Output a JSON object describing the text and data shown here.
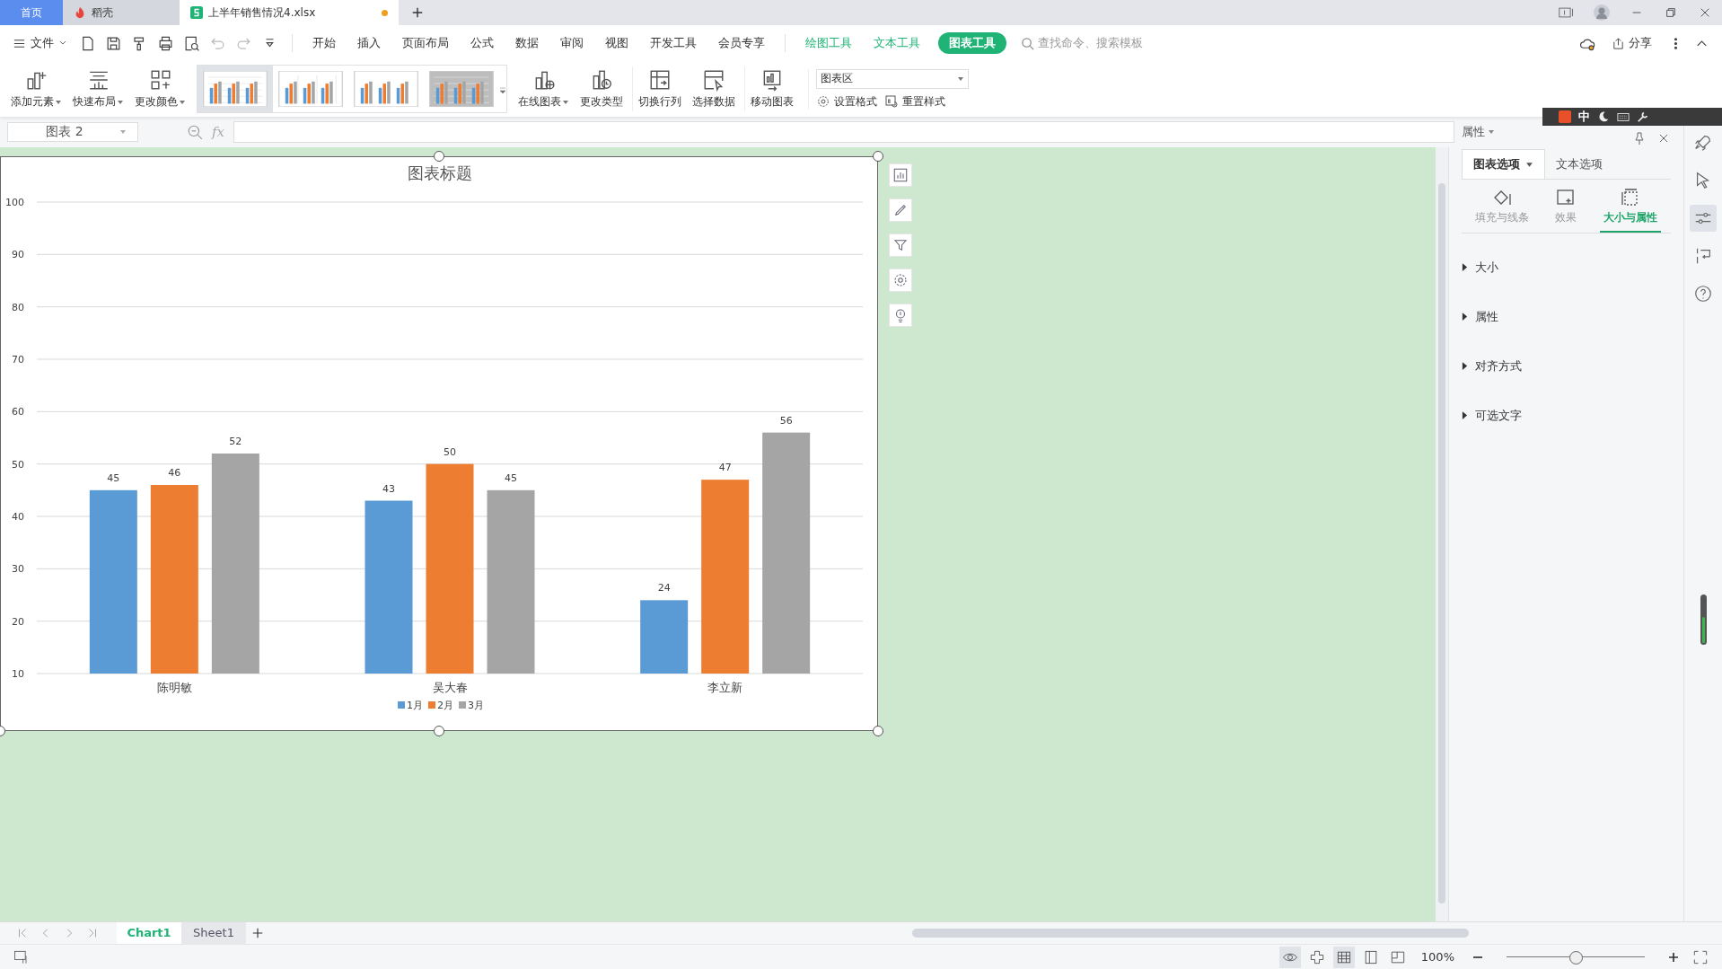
{
  "tabs": [
    {
      "label": "首页",
      "selected": false,
      "kind": "home"
    },
    {
      "label": "稻壳",
      "selected": false,
      "kind": "docer"
    },
    {
      "label": "上半年销售情况4.xlsx",
      "selected": true,
      "kind": "sheet",
      "unsaved": true
    }
  ],
  "menu": {
    "file": "文件",
    "items": [
      {
        "label": "开始",
        "kind": "plain",
        "selected": false
      },
      {
        "label": "插入",
        "kind": "plain",
        "selected": false
      },
      {
        "label": "页面布局",
        "kind": "plain",
        "selected": false
      },
      {
        "label": "公式",
        "kind": "plain",
        "selected": false
      },
      {
        "label": "数据",
        "kind": "plain",
        "selected": false
      },
      {
        "label": "审阅",
        "kind": "plain",
        "selected": false
      },
      {
        "label": "视图",
        "kind": "plain",
        "selected": false
      },
      {
        "label": "开发工具",
        "kind": "plain",
        "selected": false
      },
      {
        "label": "会员专享",
        "kind": "plain",
        "selected": false
      },
      {
        "label": "绘图工具",
        "kind": "context",
        "selected": false
      },
      {
        "label": "文本工具",
        "kind": "context",
        "selected": false
      },
      {
        "label": "图表工具",
        "kind": "context",
        "selected": true
      }
    ],
    "search_placeholder": "查找命令、搜索模板",
    "share": "分享"
  },
  "ribbon": {
    "left": [
      {
        "label": "添加元素",
        "kind": "add",
        "dropdown": true
      },
      {
        "label": "快速布局",
        "kind": "layout",
        "dropdown": true
      },
      {
        "label": "更改颜色",
        "kind": "colors",
        "dropdown": true
      }
    ],
    "styles": [
      {
        "selected": true,
        "kind": "light"
      },
      {
        "selected": false,
        "kind": "lines"
      },
      {
        "selected": false,
        "kind": "dotted"
      },
      {
        "selected": false,
        "kind": "dark"
      }
    ],
    "right": [
      {
        "label": "在线图表",
        "kind": "online",
        "dropdown": true
      },
      {
        "label": "更改类型",
        "kind": "type",
        "dropdown": false
      },
      {
        "label": "切换行列",
        "kind": "switch",
        "dropdown": false
      },
      {
        "label": "选择数据",
        "kind": "select",
        "dropdown": false
      },
      {
        "label": "移动图表",
        "kind": "move",
        "dropdown": false
      }
    ],
    "element_select": "图表区",
    "format": "设置格式",
    "reset": "重置样式"
  },
  "formula_bar": {
    "name_box": "图表 2",
    "fx": "fx"
  },
  "ime": {
    "mode": "中"
  },
  "sheet": {
    "chart": {
      "chart_data": {
        "type": "bar",
        "title": "图表标题",
        "categories": [
          "陈明敏",
          "吴大春",
          "李立新"
        ],
        "series": [
          {
            "name": "1月",
            "color": "#5b9bd5",
            "values": [
              45,
              43,
              24
            ]
          },
          {
            "name": "2月",
            "color": "#ed7d31",
            "values": [
              46,
              50,
              47
            ]
          },
          {
            "name": "3月",
            "color": "#a5a5a5",
            "values": [
              52,
              45,
              56
            ]
          }
        ],
        "ylim": [
          10,
          100
        ],
        "yticks": [
          10,
          20,
          30,
          40,
          50,
          60,
          70,
          80,
          90,
          100
        ],
        "data_labels": true,
        "grid": true,
        "legend": "bottom"
      }
    }
  },
  "panel": {
    "title": "属性",
    "tabs": [
      {
        "label": "图表选项",
        "selected": true
      },
      {
        "label": "文本选项",
        "selected": false
      }
    ],
    "subtabs": [
      {
        "label": "填充与线条",
        "selected": false,
        "kind": "fill"
      },
      {
        "label": "效果",
        "selected": false,
        "kind": "effect"
      },
      {
        "label": "大小与属性",
        "selected": true,
        "kind": "size"
      }
    ],
    "sections": [
      {
        "label": "大小",
        "expanded": false
      },
      {
        "label": "属性",
        "expanded": false
      },
      {
        "label": "对齐方式",
        "expanded": false
      },
      {
        "label": "可选文字",
        "expanded": false
      }
    ]
  },
  "sheets": [
    {
      "label": "Chart1",
      "selected": true
    },
    {
      "label": "Sheet1",
      "selected": false
    }
  ],
  "status": {
    "zoom": "100%",
    "zoom_slider": {
      "level": 0.5
    }
  }
}
